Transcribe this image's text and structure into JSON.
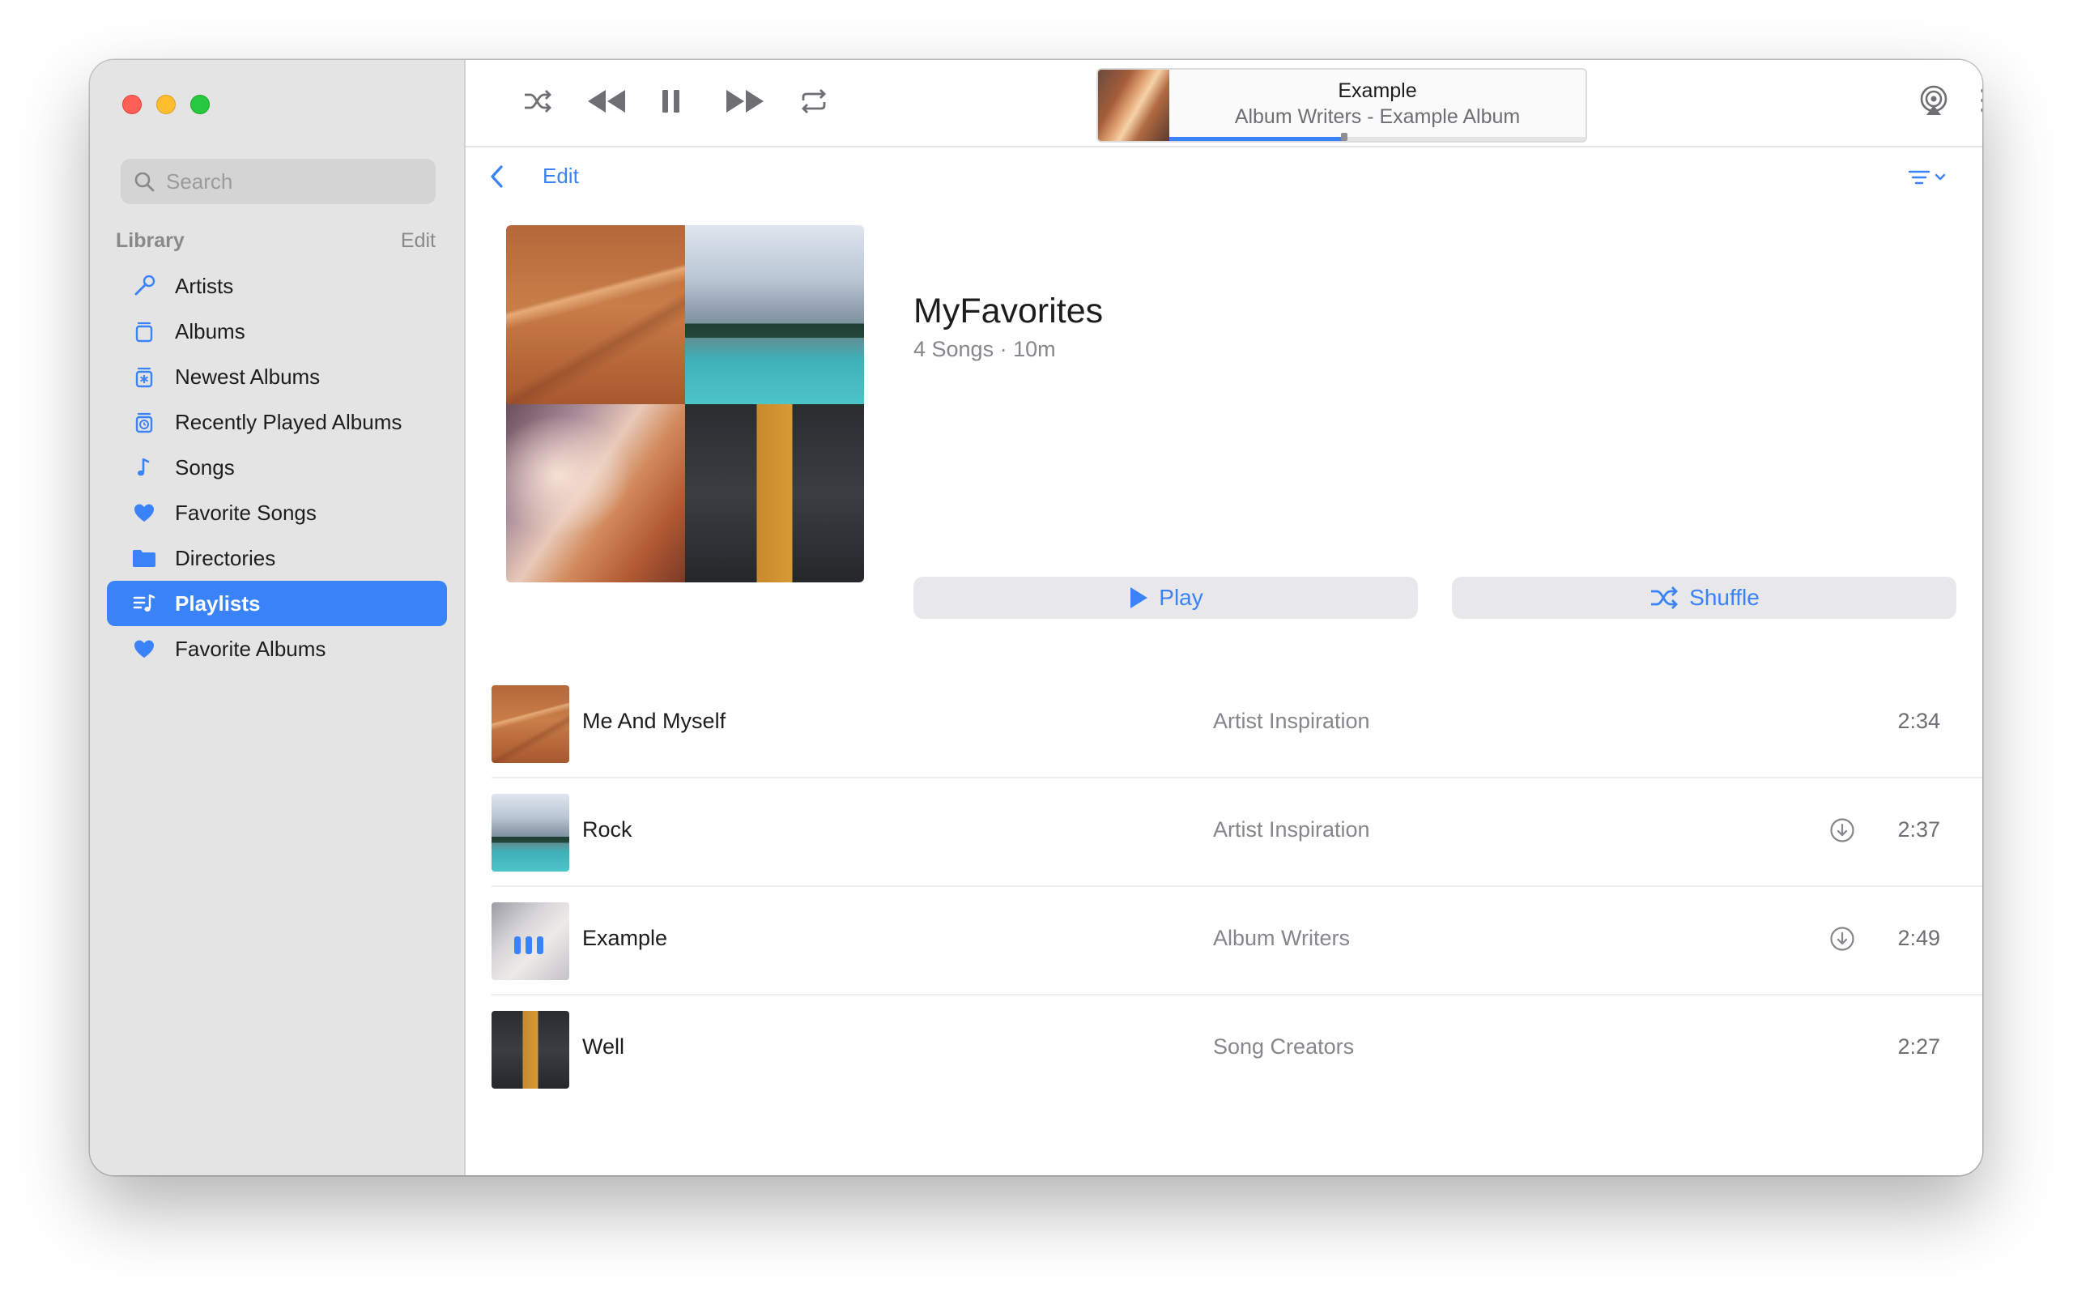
{
  "sidebar": {
    "search_placeholder": "Search",
    "library_title": "Library",
    "library_edit": "Edit",
    "items": [
      {
        "label": "Artists",
        "icon": "microphone-icon"
      },
      {
        "label": "Albums",
        "icon": "album-stack-icon"
      },
      {
        "label": "Newest Albums",
        "icon": "new-album-icon"
      },
      {
        "label": "Recently Played Albums",
        "icon": "recent-album-icon"
      },
      {
        "label": "Songs",
        "icon": "music-note-icon"
      },
      {
        "label": "Favorite Songs",
        "icon": "heart-icon"
      },
      {
        "label": "Directories",
        "icon": "folder-icon"
      },
      {
        "label": "Playlists",
        "icon": "playlist-icon",
        "active": true
      },
      {
        "label": "Favorite Albums",
        "icon": "heart-icon"
      }
    ]
  },
  "player": {
    "now_playing_title": "Example",
    "now_playing_subtitle": "Album Writers - Example Album",
    "progress": 0.42
  },
  "content": {
    "edit_label": "Edit",
    "playlist_title": "MyFavorites",
    "playlist_meta": "4 Songs · 10m",
    "play_label": "Play",
    "shuffle_label": "Shuffle"
  },
  "songs": [
    {
      "title": "Me And Myself",
      "artist": "Artist Inspiration",
      "duration": "2:34",
      "downloadable": false,
      "playing": false
    },
    {
      "title": "Rock",
      "artist": "Artist Inspiration",
      "duration": "2:37",
      "downloadable": true,
      "playing": false
    },
    {
      "title": "Example",
      "artist": "Album Writers",
      "duration": "2:49",
      "downloadable": true,
      "playing": true
    },
    {
      "title": "Well",
      "artist": "Song Creators",
      "duration": "2:27",
      "downloadable": false,
      "playing": false
    }
  ],
  "colors": {
    "accent": "#3a82f7",
    "sidebar_bg": "#e5e4e4"
  }
}
